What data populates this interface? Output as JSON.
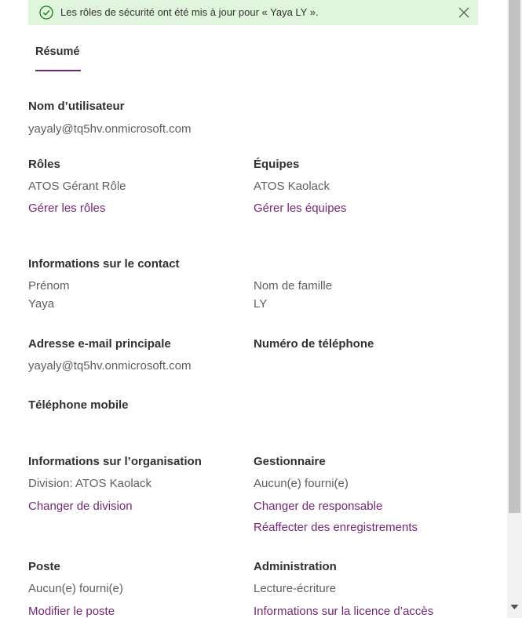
{
  "banner": {
    "message": "Les rôles de sécurité ont été mis à jour pour « Yaya LY ».",
    "icon": "check-circle-icon",
    "close_icon": "close-icon",
    "background": "#dff6dd",
    "accent": "#107c10"
  },
  "tabs": {
    "summary": "Résumé"
  },
  "accent_color": "#742774",
  "username": {
    "label": "Nom d’utilisateur",
    "value": "yayaly@tq5hv.onmicrosoft.com"
  },
  "roles": {
    "label": "Rôles",
    "value": "ATOS Gérant Rôle",
    "link": "Gérer les rôles"
  },
  "teams": {
    "label": "Équipes",
    "value": "ATOS Kaolack",
    "link": "Gérer les équipes"
  },
  "contact": {
    "heading": "Informations sur le contact",
    "first_name_label": "Prénom",
    "first_name": "Yaya",
    "last_name_label": "Nom de famille",
    "last_name": "LY",
    "email_label": "Adresse e-mail principale",
    "email": "yayaly@tq5hv.onmicrosoft.com",
    "phone_label": "Numéro de téléphone",
    "mobile_label": "Téléphone mobile"
  },
  "organization": {
    "heading": "Informations sur l’organisation",
    "division": "Division: ATOS Kaolack",
    "change_division": "Changer de division"
  },
  "manager": {
    "heading": "Gestionnaire",
    "value": "Aucun(e) fourni(e)",
    "change_manager": "Changer de responsable",
    "reassign_records": "Réaffecter des enregistrements"
  },
  "position": {
    "heading": "Poste",
    "value": "Aucun(e) fourni(e)",
    "modify": "Modifier le poste"
  },
  "administration": {
    "heading": "Administration",
    "value": "Lecture-écriture",
    "license_info": "Informations sur la licence d’accès"
  },
  "scrollbar": {
    "icon": "scroll-down-arrow-icon"
  }
}
